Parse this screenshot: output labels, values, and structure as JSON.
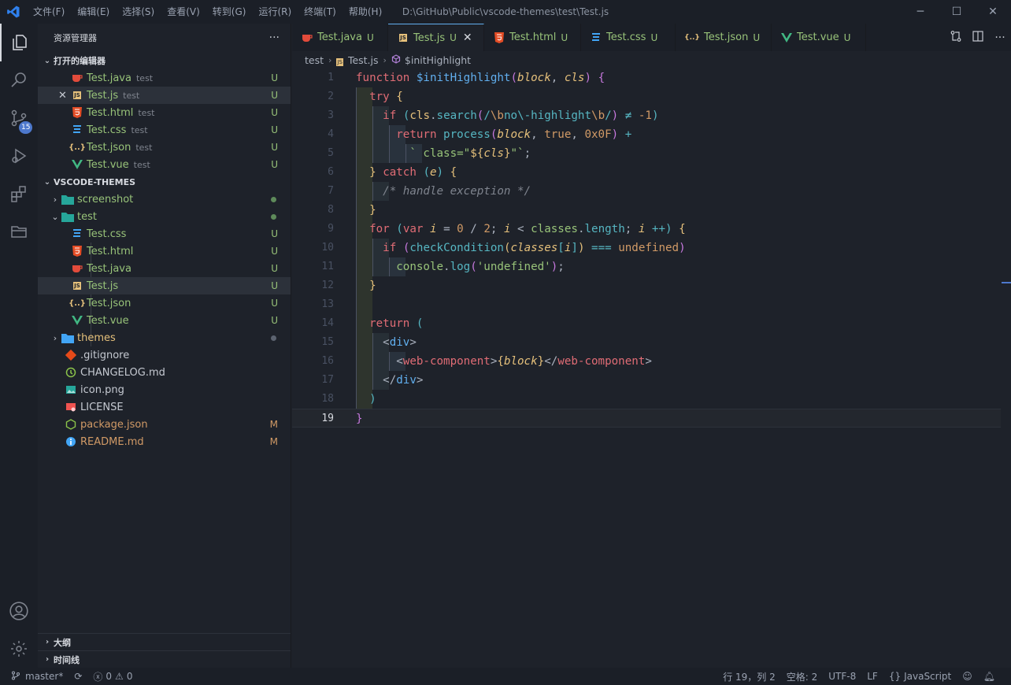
{
  "titlebar": {
    "menu": [
      "文件(F)",
      "编辑(E)",
      "选择(S)",
      "查看(V)",
      "转到(G)",
      "运行(R)",
      "终端(T)",
      "帮助(H)"
    ],
    "title": "D:\\GitHub\\Public\\vscode-themes\\test\\Test.js"
  },
  "activity": {
    "scm_badge": "15"
  },
  "sidebar": {
    "title": "资源管理器",
    "more": "···",
    "open_editors_label": "打开的编辑器",
    "open_editors": [
      {
        "name": "Test.java",
        "desc": "test",
        "status": "U"
      },
      {
        "name": "Test.js",
        "desc": "test",
        "status": "U"
      },
      {
        "name": "Test.html",
        "desc": "test",
        "status": "U"
      },
      {
        "name": "Test.css",
        "desc": "test",
        "status": "U"
      },
      {
        "name": "Test.json",
        "desc": "test",
        "status": "U"
      },
      {
        "name": "Test.vue",
        "desc": "test",
        "status": "U"
      }
    ],
    "workspace_label": "VSCODE-THEMES",
    "tree": {
      "screenshot": "screenshot",
      "test": "test",
      "test_files": [
        {
          "name": "Test.css",
          "status": "U"
        },
        {
          "name": "Test.html",
          "status": "U"
        },
        {
          "name": "Test.java",
          "status": "U"
        },
        {
          "name": "Test.js",
          "status": "U"
        },
        {
          "name": "Test.json",
          "status": "U"
        },
        {
          "name": "Test.vue",
          "status": "U"
        }
      ],
      "themes": "themes",
      "root_files": [
        {
          "name": ".gitignore",
          "status": ""
        },
        {
          "name": "CHANGELOG.md",
          "status": ""
        },
        {
          "name": "icon.png",
          "status": ""
        },
        {
          "name": "LICENSE",
          "status": ""
        },
        {
          "name": "package.json",
          "status": "M"
        },
        {
          "name": "README.md",
          "status": "M"
        }
      ]
    },
    "outline_label": "大纲",
    "timeline_label": "时间线"
  },
  "tabs": [
    {
      "name": "Test.java",
      "status": "U"
    },
    {
      "name": "Test.js",
      "status": "U"
    },
    {
      "name": "Test.html",
      "status": "U"
    },
    {
      "name": "Test.css",
      "status": "U"
    },
    {
      "name": "Test.json",
      "status": "U"
    },
    {
      "name": "Test.vue",
      "status": "U"
    }
  ],
  "breadcrumb": {
    "folder": "test",
    "file": "Test.js",
    "symbol": "$initHighlight"
  },
  "editor": {
    "line_numbers": [
      "1",
      "2",
      "3",
      "4",
      "5",
      "6",
      "7",
      "8",
      "9",
      "10",
      "11",
      "12",
      "13",
      "14",
      "15",
      "16",
      "17",
      "18",
      "19"
    ],
    "tokens": {
      "function": "function",
      "fname": "$initHighlight",
      "block": "block",
      "cls": "cls",
      "try": "try",
      "if": "if",
      "search": "search",
      "rx_a": "/",
      "rx_b": "\\b",
      "rx_c": "no",
      "rx_d": "\\-highlight",
      "rx_e": "\\b",
      "rx_f": "/",
      "neq": "≠",
      "minus1": "-1",
      "return": "return",
      "process": "process",
      "true": "true",
      "hex": "0x0F",
      "plus": "+",
      "tpl_a": "` class=\"",
      "tpl_b": "${",
      "tpl_c": "cls",
      "tpl_d": "}",
      "tpl_e": "\"`",
      "catch": "catch",
      "e": "e",
      "comment": "/* handle exception */",
      "for": "for",
      "var": "var",
      "i": "i",
      "zero": "0",
      "two": "2",
      "classes": "classes",
      "length": "length",
      "inc": "++",
      "checkCondition": "checkCondition",
      "eqq": "===",
      "undefined": "undefined",
      "console": "console",
      "log": "log",
      "str_undefined": "'undefined'",
      "div": "div",
      "webcomp": "web-component"
    }
  },
  "status": {
    "branch": "master*",
    "errors": "0",
    "warnings": "0",
    "position": "行 19，列 2",
    "spaces": "空格: 2",
    "encoding": "UTF-8",
    "eol": "LF",
    "language": "JavaScript"
  },
  "colors": {
    "accent": "#61afef",
    "untracked": "#98c379",
    "modified": "#d19a66",
    "badge": "#4d78cc"
  }
}
